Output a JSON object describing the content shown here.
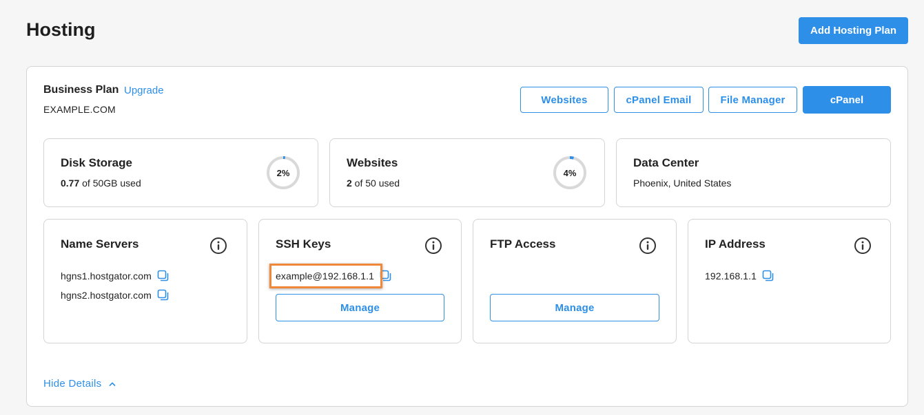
{
  "page": {
    "title": "Hosting",
    "add_plan_label": "Add Hosting Plan"
  },
  "plan": {
    "name": "Business Plan",
    "upgrade_label": "Upgrade",
    "domain": "EXAMPLE.COM",
    "buttons": {
      "websites": "Websites",
      "cpanel_email": "cPanel Email",
      "file_manager": "File Manager",
      "cpanel": "cPanel"
    }
  },
  "stats": {
    "disk": {
      "title": "Disk Storage",
      "used": "0.77",
      "rest": " of 50GB used",
      "percent_label": "2%",
      "percent": 2
    },
    "websites": {
      "title": "Websites",
      "used": "2",
      "rest": " of 50 used",
      "percent_label": "4%",
      "percent": 4
    },
    "datacenter": {
      "title": "Data Center",
      "location": "Phoenix, United States"
    }
  },
  "cards": {
    "name_servers": {
      "title": "Name Servers",
      "values": [
        "hgns1.hostgator.com",
        "hgns2.hostgator.com"
      ]
    },
    "ssh_keys": {
      "title": "SSH Keys",
      "value": "example@192.168.1.1",
      "manage_label": "Manage"
    },
    "ftp": {
      "title": "FTP Access",
      "manage_label": "Manage"
    },
    "ip": {
      "title": "IP Address",
      "value": "192.168.1.1"
    }
  },
  "footer": {
    "hide_details_label": "Hide Details"
  },
  "colors": {
    "accent": "#2d8fe8",
    "highlight": "#f0883a",
    "ring_track": "#d9d9d9"
  },
  "icons": {
    "info": "info-circle-icon",
    "copy": "copy-icon",
    "chevron": "chevron-up-icon"
  }
}
